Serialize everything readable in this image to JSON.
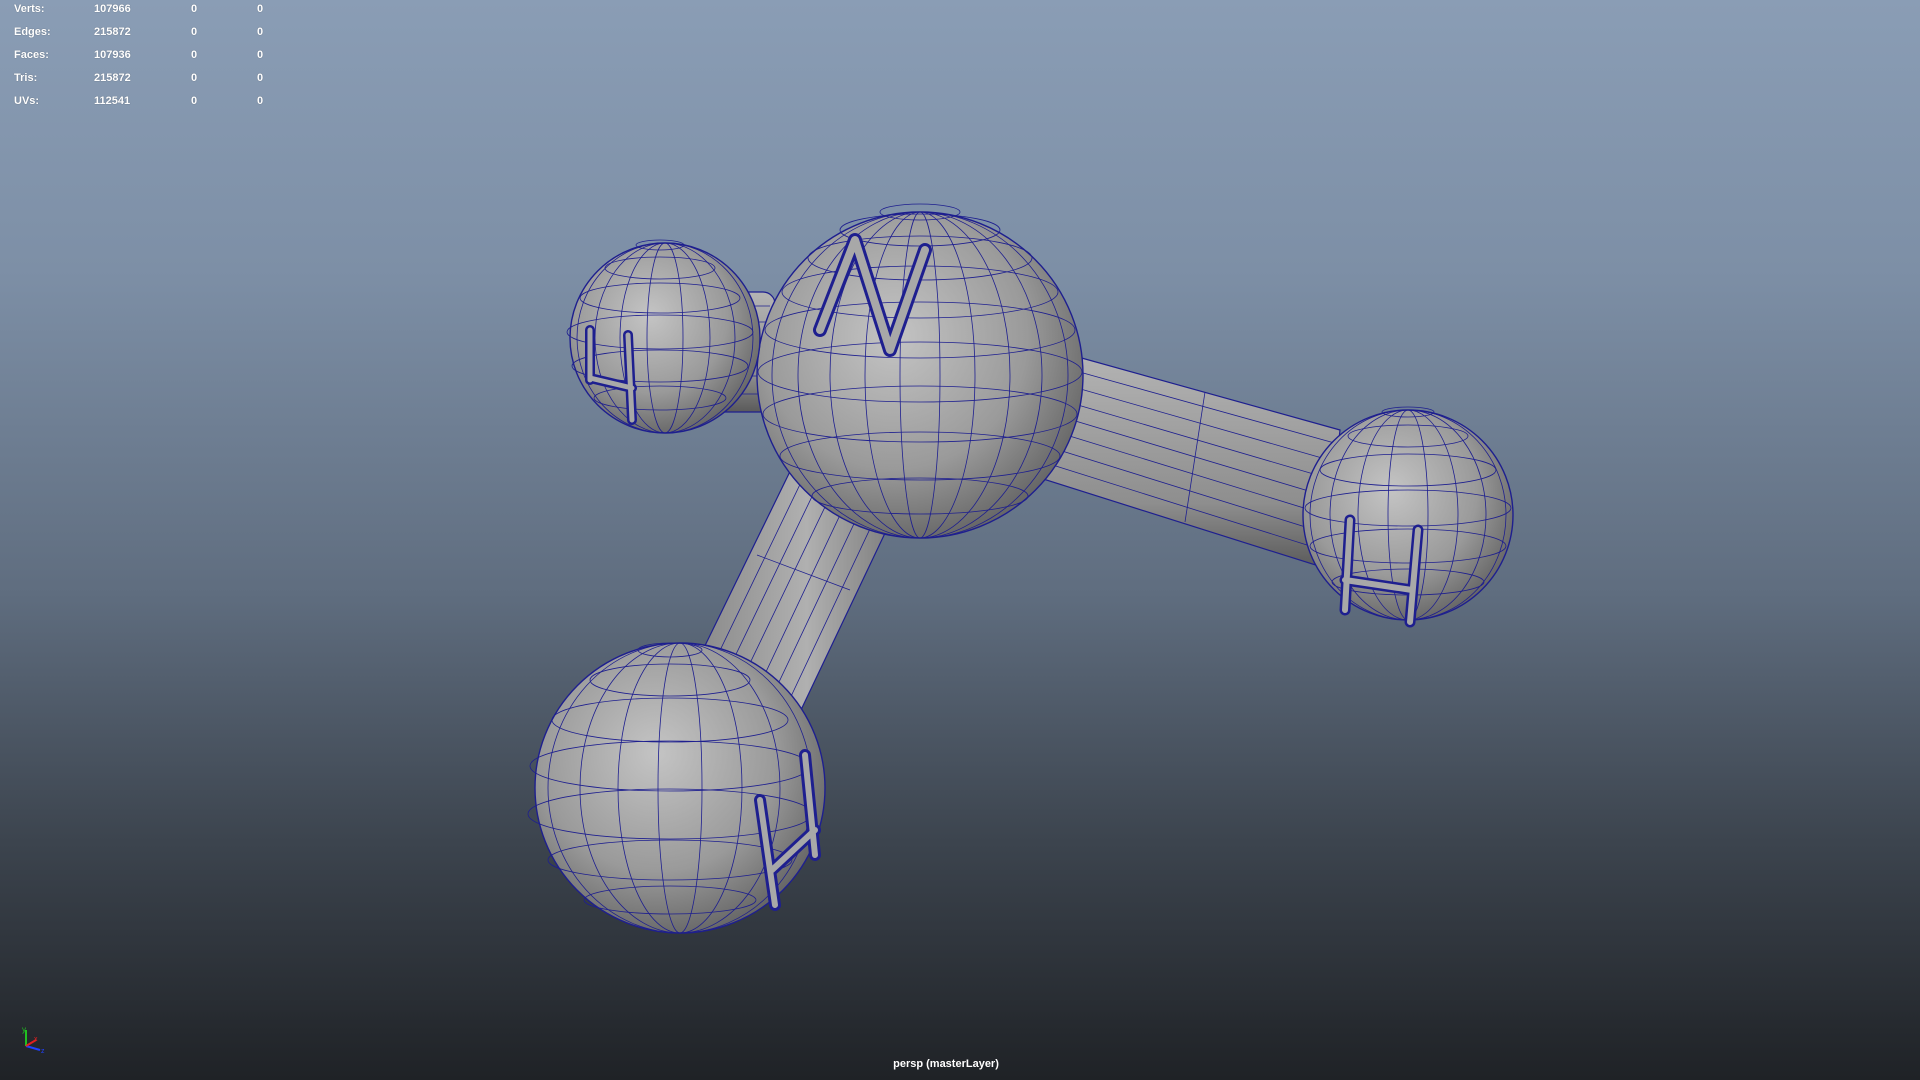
{
  "hud": {
    "rows": [
      {
        "label": "Verts:",
        "values": [
          "107966",
          "0",
          "0"
        ]
      },
      {
        "label": "Edges:",
        "values": [
          "215872",
          "0",
          "0"
        ]
      },
      {
        "label": "Faces:",
        "values": [
          "107936",
          "0",
          "0"
        ]
      },
      {
        "label": "Tris:",
        "values": [
          "215872",
          "0",
          "0"
        ]
      },
      {
        "label": "UVs:",
        "values": [
          "112541",
          "0",
          "0"
        ]
      }
    ]
  },
  "scene": {
    "description_atoms": [
      "N",
      "H",
      "H",
      "H"
    ],
    "wire_color": "#1e1f8f",
    "surface_color": "#9e9e9e"
  },
  "camera_label": "persp (masterLayer)",
  "axis_gizmo": {
    "x": "x",
    "y": "y",
    "z": "z"
  },
  "colors": {
    "axis_x": "#e02020",
    "axis_y": "#20c020",
    "axis_z": "#2040ff"
  }
}
